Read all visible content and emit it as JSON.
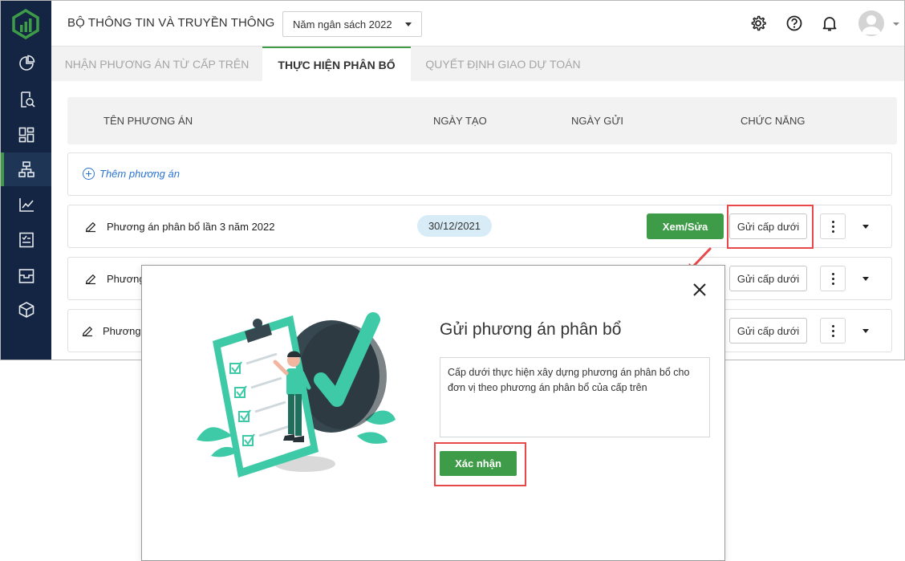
{
  "header": {
    "org_title": "BỘ THÔNG TIN VÀ TRUYỀN THÔNG",
    "budget_year": "Năm ngân sách 2022",
    "icons": [
      "gear-icon",
      "help-icon",
      "bell-icon",
      "avatar"
    ]
  },
  "sidebar": {
    "items": [
      {
        "icon": "pie-chart-icon"
      },
      {
        "icon": "document-search-icon"
      },
      {
        "icon": "dashboard-grid-icon"
      },
      {
        "icon": "hierarchy-icon",
        "active": true
      },
      {
        "icon": "line-chart-icon"
      },
      {
        "icon": "checklist-icon"
      },
      {
        "icon": "inbox-icon"
      },
      {
        "icon": "cube-icon"
      }
    ]
  },
  "tabs": [
    {
      "label": "NHẬN PHƯƠNG ÁN TỪ CẤP TRÊN",
      "active": false
    },
    {
      "label": "THỰC HIỆN PHÂN BỔ",
      "active": true
    },
    {
      "label": "QUYẾT ĐỊNH GIAO DỰ TOÁN",
      "active": false
    }
  ],
  "table": {
    "columns": [
      "TÊN PHƯƠNG ÁN",
      "NGÀY TẠO",
      "NGÀY GỬI",
      "CHỨC NĂNG"
    ],
    "add_label": "Thêm phương án",
    "rows": [
      {
        "name": "Phương án phân bổ lần 3 năm 2022",
        "created": "30/12/2021",
        "edit_label": "Xem/Sửa",
        "send_label": "Gửi cấp dưới"
      },
      {
        "name": "Phương",
        "send_label": "Gửi cấp dưới"
      },
      {
        "name": "Phương",
        "send_label": "Gửi cấp dưới"
      }
    ]
  },
  "modal": {
    "title": "Gửi phương án phân bổ",
    "message": "Cấp dưới thực hiện xây dựng phương án phân bổ cho đơn vị theo phương án phân bổ của cấp trên",
    "confirm_label": "Xác nhận"
  },
  "colors": {
    "sidebar": "#132542",
    "accent_green": "#3e9c48",
    "highlight_red": "#e8484a",
    "link_blue": "#2b74d4"
  }
}
